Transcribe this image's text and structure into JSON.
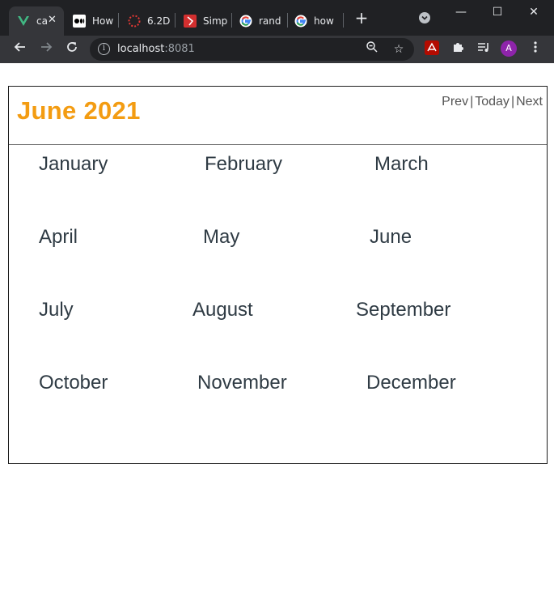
{
  "browser": {
    "tabs": [
      {
        "title": "ca",
        "icon": "vue-icon"
      },
      {
        "title": "How",
        "icon": "medium-icon"
      },
      {
        "title": "6.2D",
        "icon": "circle-dots-icon"
      },
      {
        "title": "Simp",
        "icon": "bookmark-red-icon"
      },
      {
        "title": "rand",
        "icon": "google-icon"
      },
      {
        "title": "how",
        "icon": "google-icon"
      }
    ],
    "new_tab": "+",
    "url_host": "localhost",
    "url_port": ":8081",
    "profile_initial": "A"
  },
  "calendar": {
    "title": "June 2021",
    "nav": {
      "prev": "Prev",
      "today": "Today",
      "next": "Next",
      "separator": "|"
    },
    "months": [
      "January",
      "February",
      "March",
      "April",
      "May",
      "June",
      "July",
      "August",
      "September",
      "October",
      "November",
      "December"
    ]
  },
  "colors": {
    "title": "#f39c12",
    "month_text": "#2f3b44",
    "chrome_dark": "#202124",
    "chrome_toolbar": "#35363a"
  }
}
